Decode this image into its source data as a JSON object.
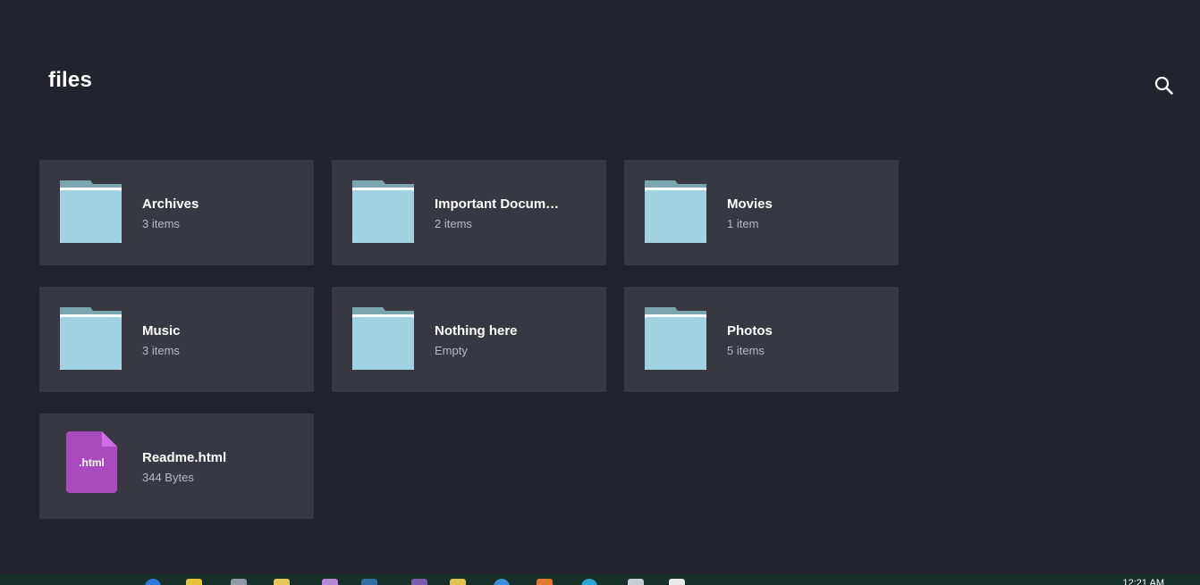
{
  "header": {
    "title": "files"
  },
  "items": [
    {
      "kind": "folder",
      "name": "Archives",
      "sub": "3 items"
    },
    {
      "kind": "folder",
      "name": "Important Docume…",
      "sub": "2 items"
    },
    {
      "kind": "folder",
      "name": "Movies",
      "sub": "1 item"
    },
    {
      "kind": "folder",
      "name": "Music",
      "sub": "3 items"
    },
    {
      "kind": "folder",
      "name": "Nothing here",
      "sub": "Empty"
    },
    {
      "kind": "folder",
      "name": "Photos",
      "sub": "5 items"
    },
    {
      "kind": "file",
      "name": "Readme.html",
      "sub": "344 Bytes",
      "ext": ".html"
    }
  ],
  "taskbar": {
    "clock": "12:21 AM"
  },
  "colors": {
    "background": "#23232d",
    "tile": "#383843",
    "folder_body": "#a0d2e2",
    "folder_tab": "#7aa6b0",
    "html_file": "#a94bbf",
    "html_file_fold": "#d26de8"
  },
  "icons": {
    "search": "search-icon",
    "folder": "folder-icon",
    "file": "html-file-icon"
  }
}
